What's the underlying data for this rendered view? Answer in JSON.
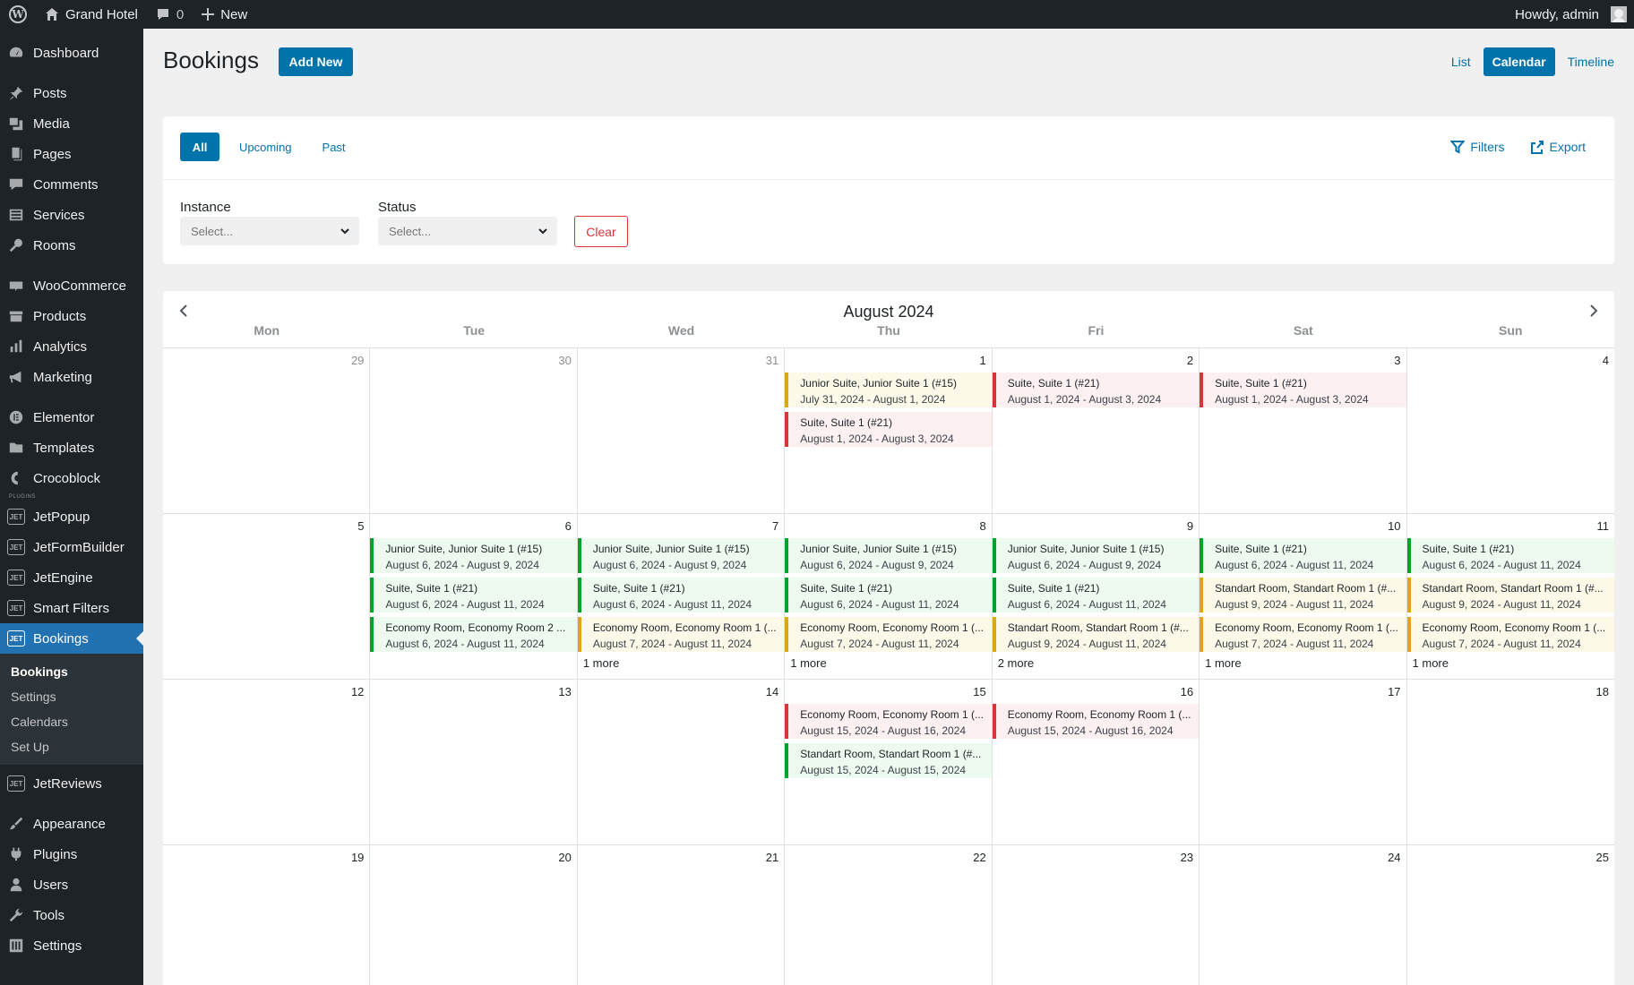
{
  "adminbar": {
    "site_name": "Grand Hotel",
    "comments_count": "0",
    "new_label": "New",
    "howdy": "Howdy, admin"
  },
  "sidebar": {
    "items": [
      {
        "label": "Dashboard"
      },
      {
        "label": "Posts"
      },
      {
        "label": "Media"
      },
      {
        "label": "Pages"
      },
      {
        "label": "Comments"
      },
      {
        "label": "Services"
      },
      {
        "label": "Rooms"
      },
      {
        "label": "WooCommerce"
      },
      {
        "label": "Products"
      },
      {
        "label": "Analytics"
      },
      {
        "label": "Marketing"
      },
      {
        "label": "Elementor"
      },
      {
        "label": "Templates"
      },
      {
        "label": "Crocoblock"
      },
      {
        "label": "JetPopup"
      },
      {
        "label": "JetFormBuilder"
      },
      {
        "label": "JetEngine"
      },
      {
        "label": "Smart Filters"
      },
      {
        "label": "Bookings"
      },
      {
        "label": "JetReviews"
      },
      {
        "label": "Appearance"
      },
      {
        "label": "Plugins"
      },
      {
        "label": "Users"
      },
      {
        "label": "Tools"
      },
      {
        "label": "Settings"
      }
    ],
    "plugins_label": "PLUGINS",
    "jet_icon": "JET",
    "submenu": [
      "Bookings",
      "Settings",
      "Calendars",
      "Set Up"
    ]
  },
  "header": {
    "title": "Bookings",
    "add_new": "Add New",
    "views": {
      "list": "List",
      "calendar": "Calendar",
      "timeline": "Timeline"
    }
  },
  "filters": {
    "tabs": [
      "All",
      "Upcoming",
      "Past"
    ],
    "filters_label": "Filters",
    "export_label": "Export",
    "instance_label": "Instance",
    "instance_placeholder": "Select...",
    "status_label": "Status",
    "status_placeholder": "Select...",
    "clear_label": "Clear"
  },
  "calendar": {
    "title": "August 2024",
    "weekdays": [
      "Mon",
      "Tue",
      "Wed",
      "Thu",
      "Fri",
      "Sat",
      "Sun"
    ],
    "weeks": [
      [
        {
          "num": "29",
          "other": true,
          "events": []
        },
        {
          "num": "30",
          "other": true,
          "events": []
        },
        {
          "num": "31",
          "other": true,
          "events": []
        },
        {
          "num": "1",
          "events": [
            {
              "title": "Junior Suite, Junior Suite 1 (#15)",
              "dates": "July 31, 2024 - August 1, 2024",
              "color": "yellow"
            },
            {
              "title": "Suite, Suite 1 (#21)",
              "dates": "August 1, 2024 - August 3, 2024",
              "color": "red"
            }
          ]
        },
        {
          "num": "2",
          "events": [
            {
              "title": "Suite, Suite 1 (#21)",
              "dates": "August 1, 2024 - August 3, 2024",
              "color": "red"
            }
          ]
        },
        {
          "num": "3",
          "events": [
            {
              "title": "Suite, Suite 1 (#21)",
              "dates": "August 1, 2024 - August 3, 2024",
              "color": "red"
            }
          ]
        },
        {
          "num": "4",
          "events": []
        }
      ],
      [
        {
          "num": "5",
          "events": []
        },
        {
          "num": "6",
          "events": [
            {
              "title": "Junior Suite, Junior Suite 1 (#15)",
              "dates": "August 6, 2024 - August 9, 2024",
              "color": "green"
            },
            {
              "title": "Suite, Suite 1 (#21)",
              "dates": "August 6, 2024 - August 11, 2024",
              "color": "green"
            },
            {
              "title": "Economy Room, Economy Room 2 ...",
              "dates": "August 6, 2024 - August 11, 2024",
              "color": "green"
            }
          ]
        },
        {
          "num": "7",
          "more": "1 more",
          "events": [
            {
              "title": "Junior Suite, Junior Suite 1 (#15)",
              "dates": "August 6, 2024 - August 9, 2024",
              "color": "green"
            },
            {
              "title": "Suite, Suite 1 (#21)",
              "dates": "August 6, 2024 - August 11, 2024",
              "color": "green"
            },
            {
              "title": "Economy Room, Economy Room 1 (...",
              "dates": "August 7, 2024 - August 11, 2024",
              "color": "yellow"
            }
          ]
        },
        {
          "num": "8",
          "more": "1 more",
          "events": [
            {
              "title": "Junior Suite, Junior Suite 1 (#15)",
              "dates": "August 6, 2024 - August 9, 2024",
              "color": "green"
            },
            {
              "title": "Suite, Suite 1 (#21)",
              "dates": "August 6, 2024 - August 11, 2024",
              "color": "green"
            },
            {
              "title": "Economy Room, Economy Room 1 (...",
              "dates": "August 7, 2024 - August 11, 2024",
              "color": "yellow"
            }
          ]
        },
        {
          "num": "9",
          "more": "2 more",
          "events": [
            {
              "title": "Junior Suite, Junior Suite 1 (#15)",
              "dates": "August 6, 2024 - August 9, 2024",
              "color": "green"
            },
            {
              "title": "Suite, Suite 1 (#21)",
              "dates": "August 6, 2024 - August 11, 2024",
              "color": "green"
            },
            {
              "title": "Standart Room, Standart Room 1 (#...",
              "dates": "August 9, 2024 - August 11, 2024",
              "color": "yellow"
            }
          ]
        },
        {
          "num": "10",
          "more": "1 more",
          "events": [
            {
              "title": "Suite, Suite 1 (#21)",
              "dates": "August 6, 2024 - August 11, 2024",
              "color": "green"
            },
            {
              "title": "Standart Room, Standart Room 1 (#...",
              "dates": "August 9, 2024 - August 11, 2024",
              "color": "yellow"
            },
            {
              "title": "Economy Room, Economy Room 1 (...",
              "dates": "August 7, 2024 - August 11, 2024",
              "color": "yellow"
            }
          ]
        },
        {
          "num": "11",
          "more": "1 more",
          "events": [
            {
              "title": "Suite, Suite 1 (#21)",
              "dates": "August 6, 2024 - August 11, 2024",
              "color": "green"
            },
            {
              "title": "Standart Room, Standart Room 1 (#...",
              "dates": "August 9, 2024 - August 11, 2024",
              "color": "yellow"
            },
            {
              "title": "Economy Room, Economy Room 1 (...",
              "dates": "August 7, 2024 - August 11, 2024",
              "color": "yellow"
            }
          ]
        }
      ],
      [
        {
          "num": "12",
          "events": []
        },
        {
          "num": "13",
          "events": []
        },
        {
          "num": "14",
          "events": []
        },
        {
          "num": "15",
          "events": [
            {
              "title": "Economy Room, Economy Room 1 (...",
              "dates": "August 15, 2024 - August 16, 2024",
              "color": "red"
            },
            {
              "title": "Standart Room, Standart Room 1 (#...",
              "dates": "August 15, 2024 - August 15, 2024",
              "color": "green"
            }
          ]
        },
        {
          "num": "16",
          "events": [
            {
              "title": "Economy Room, Economy Room 1 (...",
              "dates": "August 15, 2024 - August 16, 2024",
              "color": "red"
            }
          ]
        },
        {
          "num": "17",
          "events": []
        },
        {
          "num": "18",
          "events": []
        }
      ],
      [
        {
          "num": "19",
          "events": []
        },
        {
          "num": "20",
          "events": []
        },
        {
          "num": "21",
          "events": []
        },
        {
          "num": "22",
          "events": []
        },
        {
          "num": "23",
          "events": []
        },
        {
          "num": "24",
          "events": []
        },
        {
          "num": "25",
          "events": []
        }
      ]
    ]
  }
}
